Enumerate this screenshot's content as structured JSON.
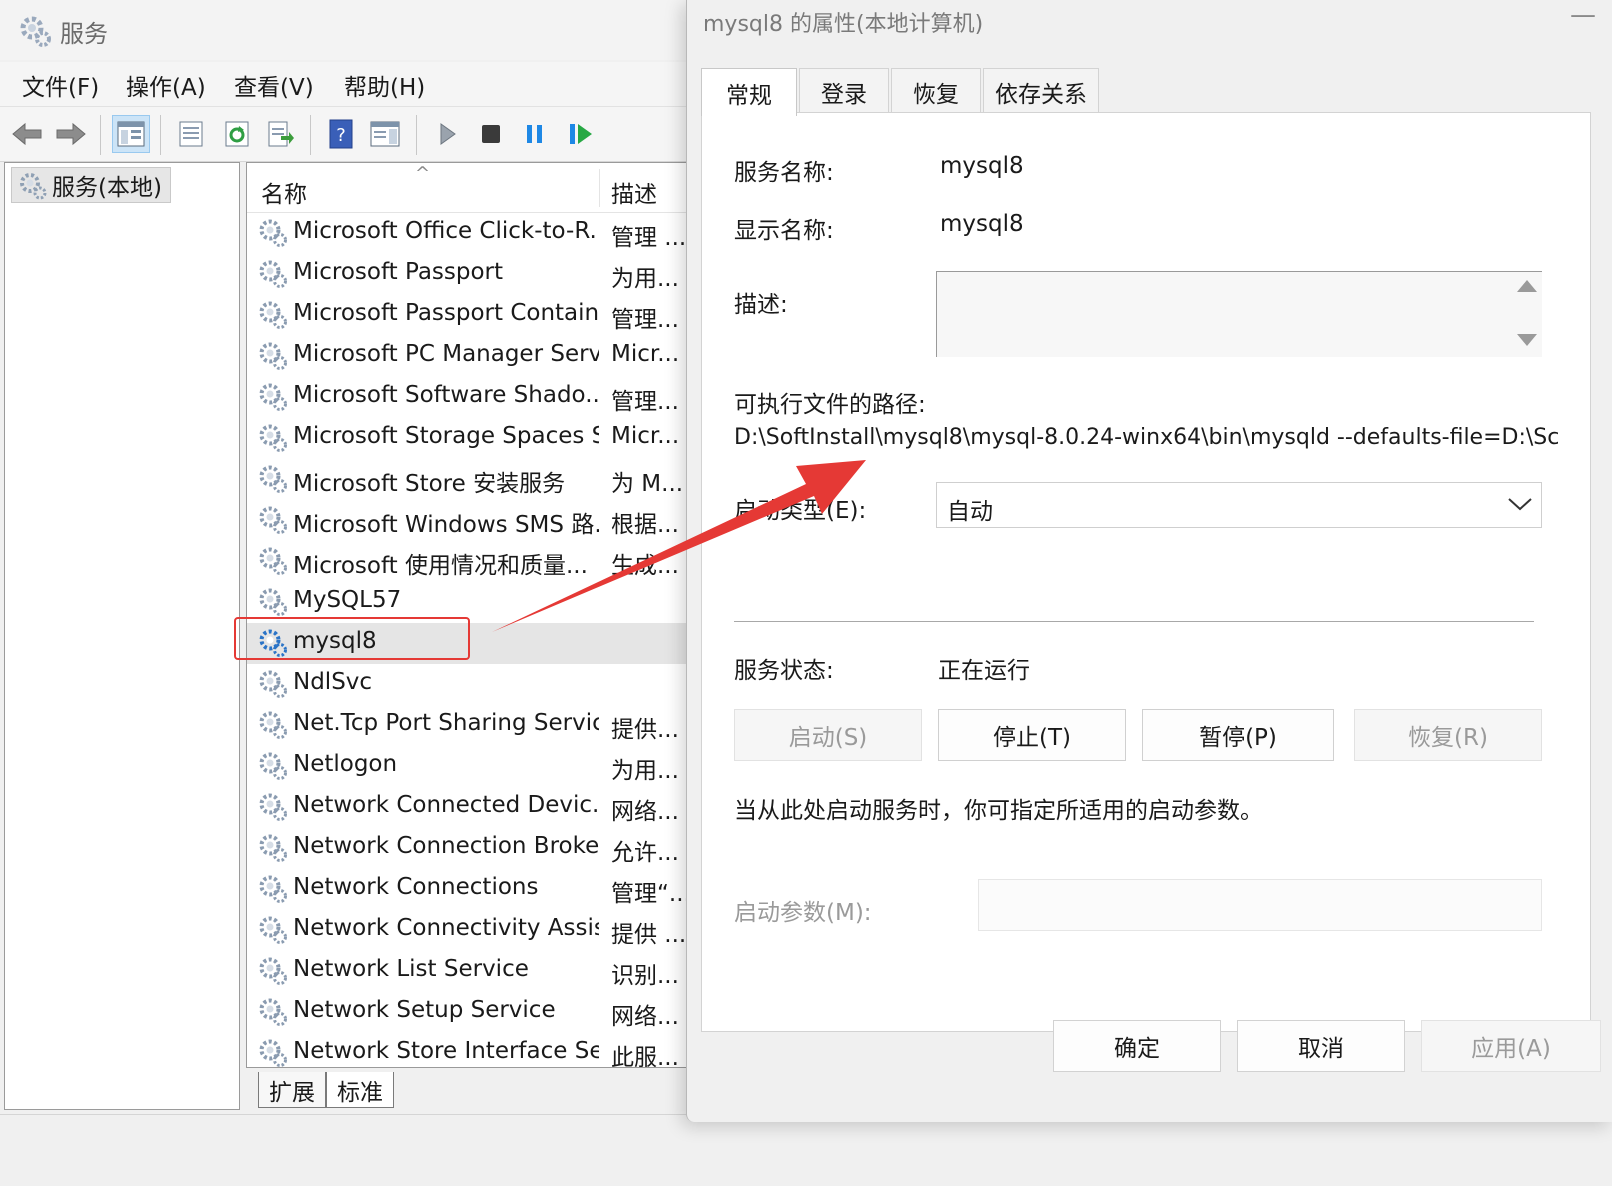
{
  "services_window": {
    "title": "服务",
    "menu": [
      "文件(F)",
      "操作(A)",
      "查看(V)",
      "帮助(H)"
    ],
    "tree_node": "服务(本地)",
    "columns": {
      "name": "名称",
      "description": "描述"
    },
    "services": [
      {
        "name": "Microsoft Office Click-to-R...",
        "desc": "管理 ..."
      },
      {
        "name": "Microsoft Passport",
        "desc": "为用..."
      },
      {
        "name": "Microsoft Passport Container",
        "desc": "管理..."
      },
      {
        "name": "Microsoft PC Manager Serv...",
        "desc": "Micr..."
      },
      {
        "name": "Microsoft Software Shado...",
        "desc": "管理..."
      },
      {
        "name": "Microsoft Storage Spaces S...",
        "desc": "Micr..."
      },
      {
        "name": "Microsoft Store 安装服务",
        "desc": "为 M..."
      },
      {
        "name": "Microsoft Windows SMS 路...",
        "desc": "根据..."
      },
      {
        "name": "Microsoft 使用情况和质量...",
        "desc": "生成..."
      },
      {
        "name": "MySQL57",
        "desc": ""
      },
      {
        "name": "mysql8",
        "desc": ""
      },
      {
        "name": "NdlSvc",
        "desc": ""
      },
      {
        "name": "Net.Tcp Port Sharing Service",
        "desc": "提供..."
      },
      {
        "name": "Netlogon",
        "desc": "为用..."
      },
      {
        "name": "Network Connected Devic...",
        "desc": "网络..."
      },
      {
        "name": "Network Connection Broker",
        "desc": "允许..."
      },
      {
        "name": "Network Connections",
        "desc": "管理“..."
      },
      {
        "name": "Network Connectivity Assis...",
        "desc": "提供 ..."
      },
      {
        "name": "Network List Service",
        "desc": "识别..."
      },
      {
        "name": "Network Setup Service",
        "desc": "网络..."
      },
      {
        "name": "Network Store Interface Se...",
        "desc": "此服..."
      }
    ],
    "selected_service": "mysql8",
    "bottom_tabs": [
      "扩展",
      "标准"
    ]
  },
  "dialog": {
    "title": "mysql8 的属性(本地计算机)",
    "tabs": [
      "常规",
      "登录",
      "恢复",
      "依存关系"
    ],
    "active_tab": "常规",
    "service_name_label": "服务名称:",
    "service_name_value": "mysql8",
    "display_name_label": "显示名称:",
    "display_name_value": "mysql8",
    "description_label": "描述:",
    "path_label": "可执行文件的路径:",
    "path_value": "D:\\SoftInstall\\mysql8\\mysql-8.0.24-winx64\\bin\\mysqld --defaults-file=D:\\Sc",
    "startup_type_label": "启动类型(E):",
    "startup_type_value": "自动",
    "status_label": "服务状态:",
    "status_value": "正在运行",
    "buttons": {
      "start": "启动(S)",
      "stop": "停止(T)",
      "pause": "暂停(P)",
      "resume": "恢复(R)"
    },
    "params_hint": "当从此处启动服务时，你可指定所适用的启动参数。",
    "params_label": "启动参数(M):",
    "footer": {
      "ok": "确定",
      "cancel": "取消",
      "apply": "应用(A)"
    }
  },
  "colors": {
    "annotation_red": "#e53935",
    "gear_blue": "#2b74c7",
    "gear_gray": "#8a9bb0"
  }
}
